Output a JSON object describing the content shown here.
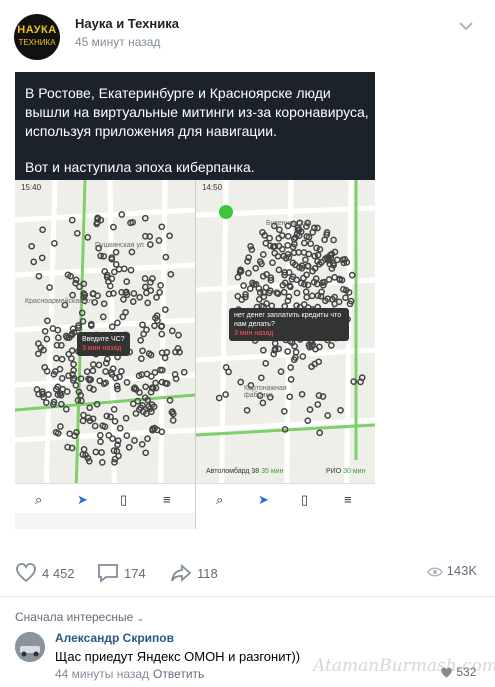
{
  "post": {
    "group_name": "Наука и Техника",
    "time": "45 минут назад",
    "avatar_line1": "НАУКА",
    "avatar_line2": "ТЕХНИКА",
    "caption_line1": "В Ростове, Екатеринбурге и Красноярске люди вышли на виртуальные митинги из-за коронавируса, используя приложения для навигации.",
    "caption_line2": "Вот и наступила эпоха киберпанка."
  },
  "map_left": {
    "status_time": "15:40",
    "street1": "Пушкинская ул",
    "street2": "Красноармейская ул.",
    "bubble_title": "Введите ЧС?",
    "bubble_sub": "3 мин назад"
  },
  "map_right": {
    "status_time": "14:50",
    "street1": "Буденновская",
    "street2": "Картонажная фабрика",
    "bubble_title": "нет денег заплатить кредиты что нам делать?",
    "bubble_sub": "3 мин назад",
    "route1": "Автоломбард 38",
    "route1_time": "35 мин",
    "route2": "РИО",
    "route2_time": "30 мин"
  },
  "reactions": {
    "likes": "4 452",
    "comments": "174",
    "shares": "118",
    "views": "143K"
  },
  "comments": {
    "sort_label": "Сначала интересные",
    "author": "Александр Скрипов",
    "text": "Щас приедут Яндекс ОМОН и разгонит))",
    "time": "44 минуты назад",
    "reply_label": "Ответить",
    "likes": "532"
  },
  "watermark": "AtamanBurmash.com"
}
